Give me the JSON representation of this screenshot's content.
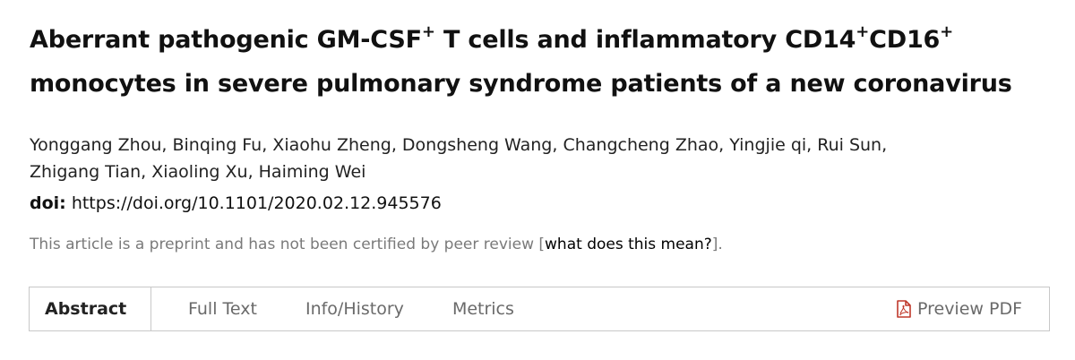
{
  "article": {
    "title_part1": "Aberrant pathogenic GM-CSF",
    "title_sup1": "+",
    "title_part2": " T cells and inflammatory CD14",
    "title_sup2": "+",
    "title_part3": "CD16",
    "title_sup3": "+",
    "title_part4": "monocytes in severe pulmonary syndrome patients of a new coronavirus",
    "authors_line1": "Yonggang Zhou, Binqing Fu, Xiaohu Zheng, Dongsheng Wang, Changcheng Zhao, Yingjie qi, Rui Sun,",
    "authors_line2": "Zhigang Tian, Xiaoling Xu, Haiming Wei",
    "doi_label": "doi:",
    "doi_value": "https://doi.org/10.1101/2020.02.12.945576",
    "preprint_note": "This article is a preprint and has not been certified by peer review ",
    "preprint_bracket_open": "[",
    "preprint_link": "what does this mean?",
    "preprint_bracket_close": "]."
  },
  "tabs": [
    {
      "label": "Abstract",
      "active": true
    },
    {
      "label": "Full Text",
      "active": false
    },
    {
      "label": "Info/History",
      "active": false
    },
    {
      "label": "Metrics",
      "active": false
    }
  ],
  "pdf": {
    "label": "Preview PDF",
    "icon": "pdf-file-icon",
    "icon_color": "#c0392b"
  }
}
